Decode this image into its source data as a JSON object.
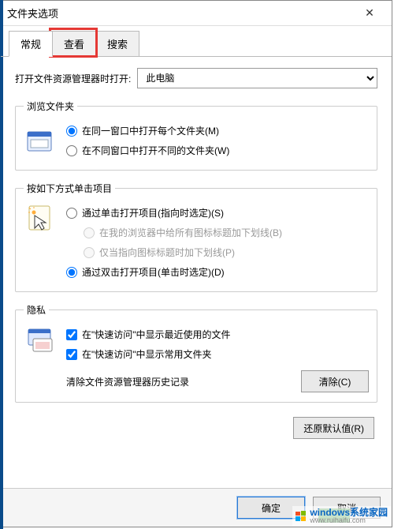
{
  "window": {
    "title": "文件夹选项",
    "close_glyph": "✕"
  },
  "tabs": {
    "items": [
      {
        "label": "常规"
      },
      {
        "label": "查看"
      },
      {
        "label": "搜索"
      }
    ],
    "highlighted_index": 1
  },
  "open_with": {
    "label": "打开文件资源管理器时打开:",
    "value": "此电脑"
  },
  "browse_group": {
    "legend": "浏览文件夹",
    "opt_same": "在同一窗口中打开每个文件夹(M)",
    "opt_new": "在不同窗口中打开不同的文件夹(W)",
    "selected": "same"
  },
  "click_group": {
    "legend": "按如下方式单击项目",
    "opt_single": "通过单击打开项目(指向时选定)(S)",
    "sub_browser": "在我的浏览器中给所有图标标题加下划线(B)",
    "sub_point": "仅当指向图标标题时加下划线(P)",
    "opt_double": "通过双击打开项目(单击时选定)(D)",
    "selected": "double"
  },
  "privacy_group": {
    "legend": "隐私",
    "chk_recent": "在\"快速访问\"中显示最近使用的文件",
    "chk_frequent": "在\"快速访问\"中显示常用文件夹",
    "clear_label": "清除文件资源管理器历史记录",
    "clear_btn": "清除(C)",
    "recent_checked": true,
    "frequent_checked": true
  },
  "restore_btn": "还原默认值(R)",
  "footer": {
    "ok": "确定",
    "cancel": "取消"
  },
  "watermark": {
    "text": "windows系统家园",
    "sub": "www.ruihaifu.com"
  }
}
